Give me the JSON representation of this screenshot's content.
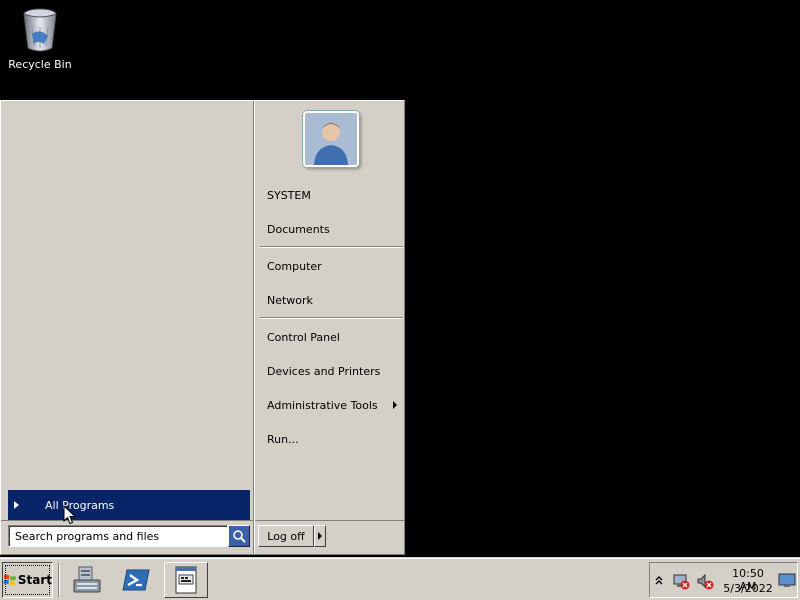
{
  "desktop": {
    "recycle_bin_label": "Recycle Bin"
  },
  "start_menu": {
    "all_programs_label": "All Programs",
    "search_placeholder": "Search programs and files",
    "log_off_label": "Log off",
    "right_items": [
      {
        "label": "SYSTEM"
      },
      {
        "label": "Documents"
      },
      {
        "label": "Computer"
      },
      {
        "label": "Network"
      },
      {
        "label": "Control Panel"
      },
      {
        "label": "Devices and Printers"
      },
      {
        "label": "Administrative Tools",
        "has_submenu": true
      },
      {
        "label": "Run..."
      }
    ]
  },
  "taskbar": {
    "start_label": "Start",
    "quick_launch": [
      {
        "icon": "server-manager-icon"
      },
      {
        "icon": "powershell-icon"
      },
      {
        "icon": "explorer-window-icon",
        "active": true
      }
    ],
    "tray": {
      "icons": [
        "show-hidden-icons-chevron",
        "network-error-icon",
        "speaker-muted-icon",
        "show-desktop-icon"
      ],
      "time": "10:50 AM",
      "date": "5/3/2022"
    }
  },
  "colors": {
    "desktop_background": "#000000",
    "menu_background": "#d4d0c8",
    "selection_highlight": "#0a246a",
    "selection_text": "#ffffff"
  }
}
